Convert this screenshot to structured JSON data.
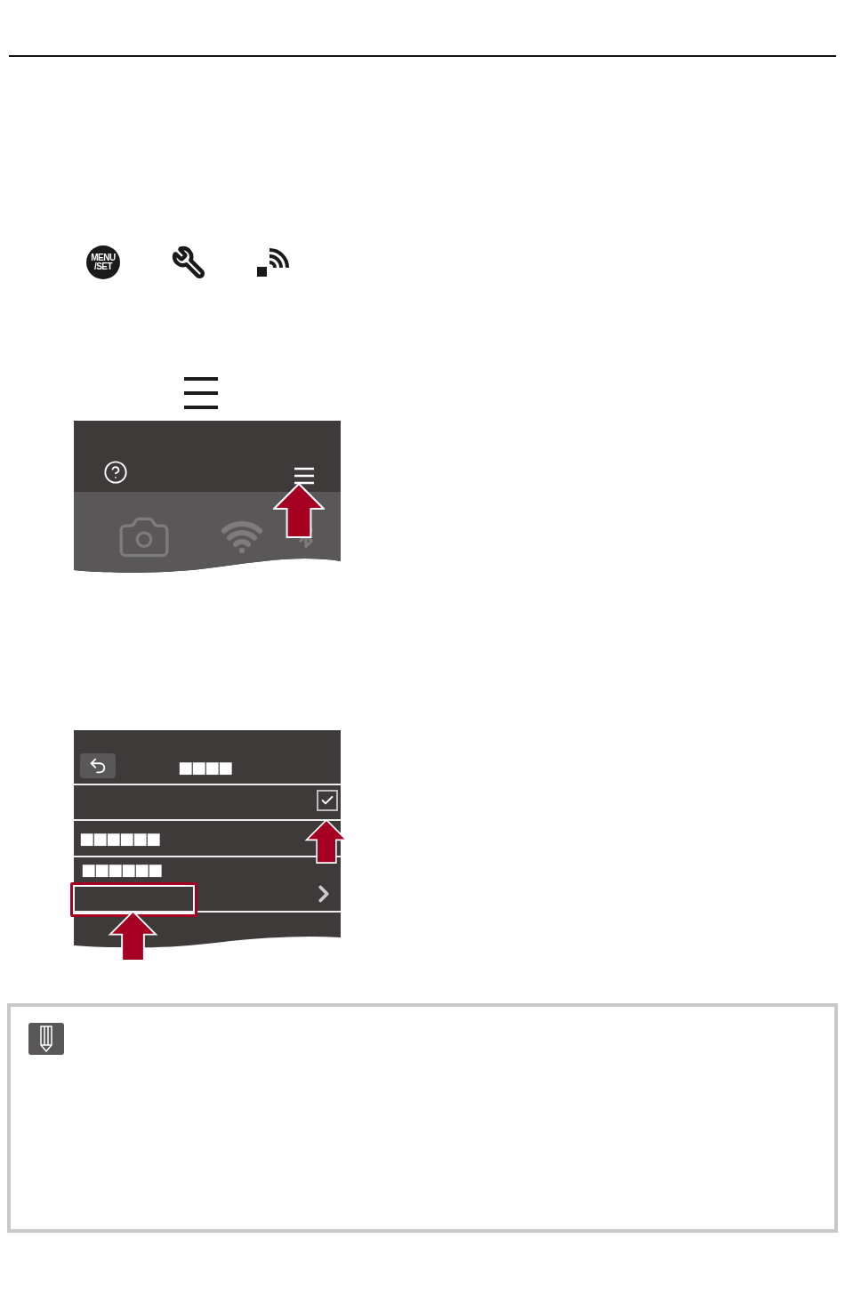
{
  "header_icons": [
    {
      "kind": "menu_set",
      "lines": [
        "MENU",
        "/SET"
      ]
    },
    {
      "kind": "wrench"
    },
    {
      "kind": "wireless"
    }
  ],
  "screen_2": {
    "title": "■■■■",
    "rows": [
      {
        "kind": "checkbox",
        "checked": true
      },
      {
        "kind": "label",
        "label": "■■■■■■"
      },
      {
        "kind": "submenu",
        "label": "■■■■■■",
        "highlighted": true
      },
      {
        "kind": "blank"
      }
    ]
  }
}
